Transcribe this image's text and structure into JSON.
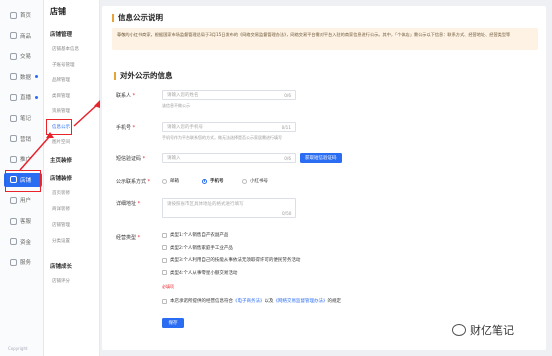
{
  "rail": {
    "items": [
      {
        "label": "首页",
        "icon": "home-icon"
      },
      {
        "label": "商品",
        "icon": "goods-icon"
      },
      {
        "label": "交易",
        "icon": "order-icon"
      },
      {
        "label": "数据",
        "icon": "chart-icon",
        "dot": true
      },
      {
        "label": "直播",
        "icon": "live-icon",
        "dot": true
      },
      {
        "label": "笔记",
        "icon": "note-icon"
      },
      {
        "label": "营销",
        "icon": "megaphone-icon"
      },
      {
        "label": "推广",
        "icon": "promote-icon"
      },
      {
        "label": "店铺",
        "icon": "store-icon",
        "active": true
      },
      {
        "label": "用户",
        "icon": "user-icon"
      },
      {
        "label": "客服",
        "icon": "service-icon"
      },
      {
        "label": "资金",
        "icon": "wallet-icon"
      },
      {
        "label": "服务",
        "icon": "settings-icon"
      }
    ],
    "footer": "Copyright"
  },
  "sub": {
    "title": "店铺",
    "group1": "店铺管理",
    "group1_items": [
      "店铺基本信息",
      "子账号管理",
      "品牌管理",
      "类目管理",
      "资质管理",
      "信息公示",
      "图片空间"
    ],
    "active_item": "信息公示",
    "group2": "主页装修",
    "group3": "店铺装修",
    "group3_items": [
      "首页装修",
      "商详装修",
      "店铺管理",
      "分类设置"
    ],
    "group4": "店铺成长",
    "group4_items": [
      "店铺评分"
    ]
  },
  "main": {
    "title": "信息公示说明",
    "notice": "尊敬的小红书商家，根据国家市场监督管理总局于3月15日发布的《网络交易监督管理办法》，网络交易平台需对平台入驻的商家信息进行公示。其中，「个体店」需公示以下信息：联系方式、经营地址、经营类型等",
    "section_title": "对外公示的信息",
    "contact": {
      "label": "联系人",
      "placeholder": "请输入您的姓名",
      "count": "0/6",
      "hint": "该信息不做公示"
    },
    "phone": {
      "label": "手机号",
      "placeholder": "请输入您的手机号",
      "count": "0/11",
      "hint": "手机号作为平台联系您的方式，做无法选择是否公示家居需进行填写"
    },
    "sms": {
      "label": "短信验证码",
      "placeholder": "请输入",
      "count": "0/6",
      "button": "获取短信验证码"
    },
    "public_contact": {
      "label": "公示联系方式",
      "options": [
        "邮箱",
        "手机号",
        "小红书号"
      ],
      "selected": "手机号"
    },
    "address": {
      "label": "详细地址",
      "placeholder": "请按照省市区具体地址的格式进行填写",
      "count": "0/50"
    },
    "business_type": {
      "label": "经营类型",
      "options": [
        "类型1:个人销售自产农副产品",
        "类型2:个人销售家庭手工业产品",
        "类型3:个人利用自己的技能从事依法无须取得许可的便民劳务活动",
        "类型4:个人从事零星小额交易活动"
      ],
      "error": "必填项"
    },
    "agreement": {
      "prefix": "本店承诺所提供的经营信息符合",
      "law1": "《电子商务法》",
      "mid": "以及",
      "law2": "《网络交易监督管理办法》",
      "suffix": "的规定"
    },
    "save_label": "保存"
  },
  "watermark": "财亿笔记"
}
